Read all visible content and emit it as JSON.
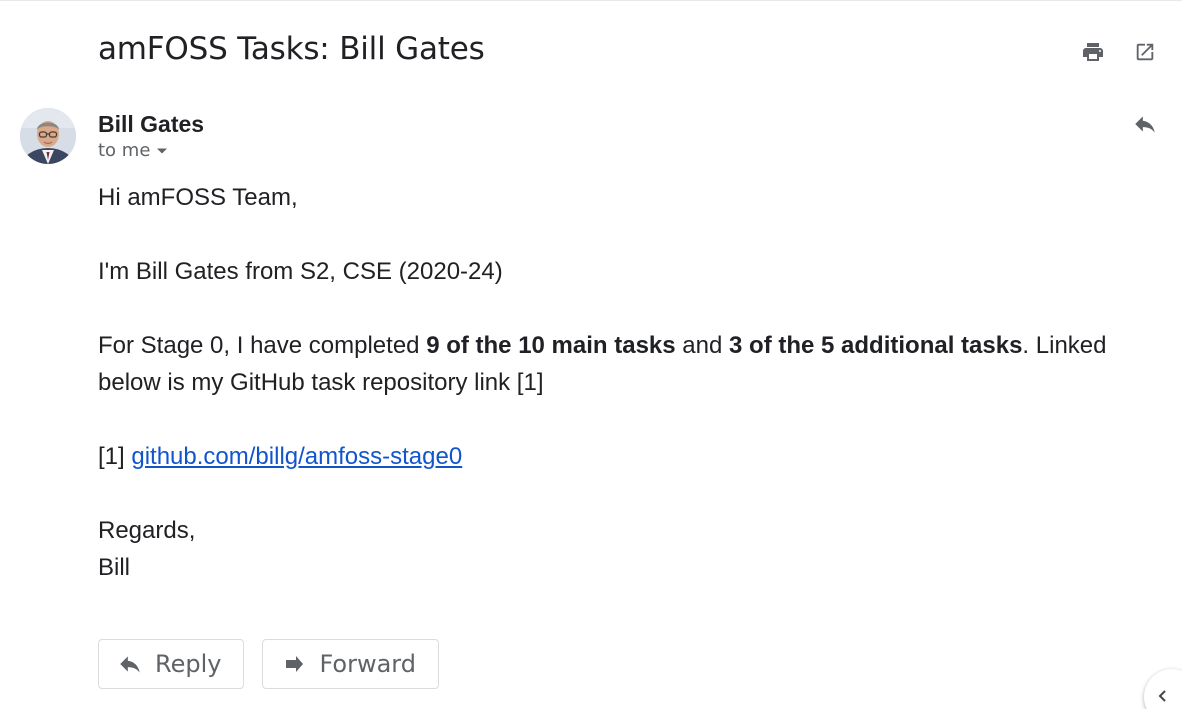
{
  "email": {
    "subject": "amFOSS Tasks: Bill Gates",
    "sender_name": "Bill Gates",
    "recipient_label": "to me"
  },
  "body": {
    "greeting": "Hi amFOSS Team,",
    "intro": "I'm Bill Gates from S2, CSE (2020-24)",
    "stage_prefix": "For Stage 0, I have completed ",
    "main_tasks": "9 of the 10 main tasks",
    "and_text": " and ",
    "additional_tasks": "3 of the 5 additional tasks",
    "stage_suffix": ". Linked below is my GitHub task repository link [1]",
    "ref_marker": "[1] ",
    "ref_link": "github.com/billg/amfoss-stage0",
    "closing": "Regards,",
    "signature": "Bill"
  },
  "actions": {
    "reply_label": "Reply",
    "forward_label": "Forward"
  },
  "icons": {
    "print": "print-icon",
    "open_new_window": "open-in-new-window-icon",
    "reply": "reply-icon",
    "forward": "forward-icon",
    "dropdown": "caret-down-icon",
    "collapse": "chevron-left-icon"
  },
  "colors": {
    "text": "#202124",
    "muted": "#5f6368",
    "link": "#1155cc",
    "border": "#dadce0"
  }
}
